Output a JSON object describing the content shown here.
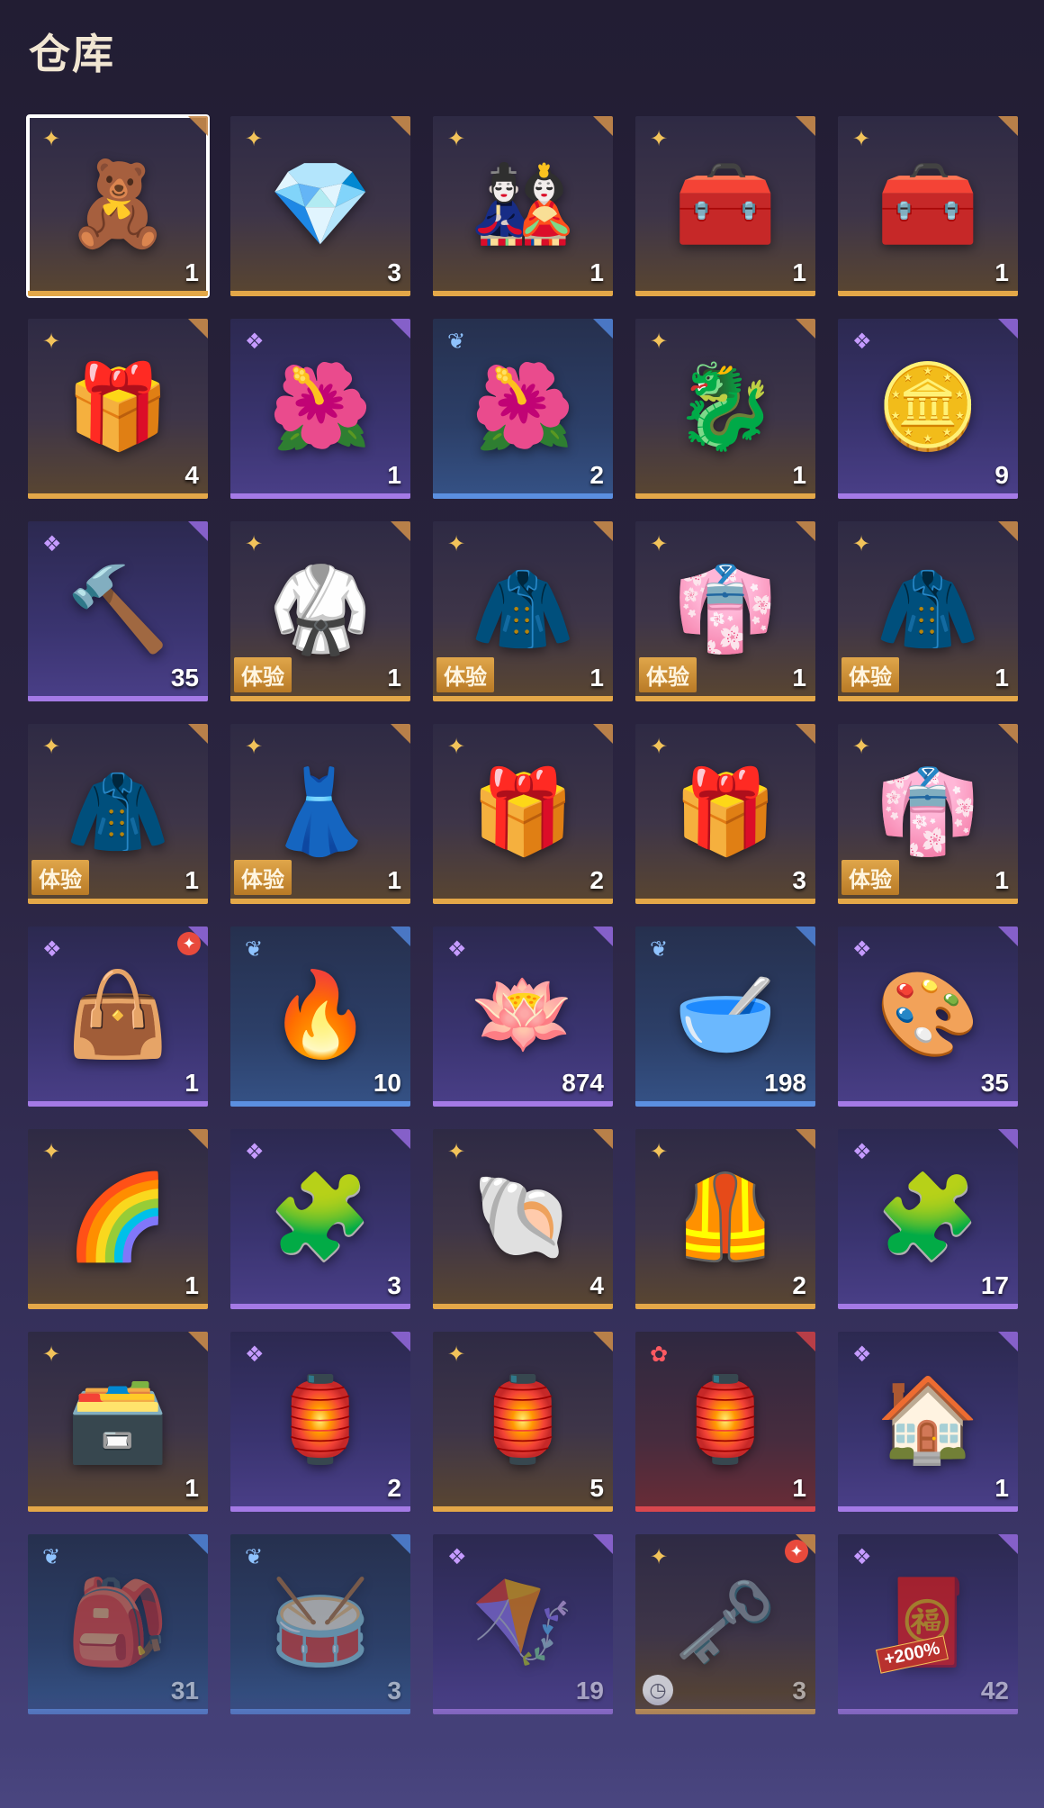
{
  "header": {
    "title": "仓库"
  },
  "trial_label": "体验",
  "items": [
    {
      "rarity": "gold",
      "art": "🧸",
      "qty": "1",
      "selected": true
    },
    {
      "rarity": "gold",
      "art": "💎",
      "qty": "3"
    },
    {
      "rarity": "gold",
      "art": "🎎",
      "qty": "1"
    },
    {
      "rarity": "gold",
      "art": "🧰",
      "qty": "1"
    },
    {
      "rarity": "gold",
      "art": "🧰",
      "qty": "1"
    },
    {
      "rarity": "gold",
      "art": "🎁",
      "qty": "4"
    },
    {
      "rarity": "purple",
      "art": "🌺",
      "qty": "1"
    },
    {
      "rarity": "blue",
      "art": "🌺",
      "qty": "2"
    },
    {
      "rarity": "gold",
      "art": "🐉",
      "qty": "1"
    },
    {
      "rarity": "purple",
      "art": "🪙",
      "qty": "9"
    },
    {
      "rarity": "purple",
      "art": "🔨",
      "qty": "35"
    },
    {
      "rarity": "gold",
      "art": "🥋",
      "qty": "1",
      "trial": true
    },
    {
      "rarity": "gold",
      "art": "🧥",
      "qty": "1",
      "trial": true
    },
    {
      "rarity": "gold",
      "art": "👘",
      "qty": "1",
      "trial": true
    },
    {
      "rarity": "gold",
      "art": "🧥",
      "qty": "1",
      "trial": true
    },
    {
      "rarity": "gold",
      "art": "🧥",
      "qty": "1",
      "trial": true
    },
    {
      "rarity": "gold",
      "art": "👗",
      "qty": "1",
      "trial": true
    },
    {
      "rarity": "gold",
      "art": "🎁",
      "qty": "2"
    },
    {
      "rarity": "gold",
      "art": "🎁",
      "qty": "3"
    },
    {
      "rarity": "gold",
      "art": "👘",
      "qty": "1",
      "trial": true
    },
    {
      "rarity": "purple",
      "art": "👜",
      "qty": "1",
      "badge": true
    },
    {
      "rarity": "blue",
      "art": "🔥",
      "qty": "10"
    },
    {
      "rarity": "purple",
      "art": "🪷",
      "qty": "874"
    },
    {
      "rarity": "blue",
      "art": "🥣",
      "qty": "198"
    },
    {
      "rarity": "purple",
      "art": "🎨",
      "qty": "35"
    },
    {
      "rarity": "gold",
      "art": "🌈",
      "qty": "1"
    },
    {
      "rarity": "purple",
      "art": "🧩",
      "qty": "3"
    },
    {
      "rarity": "gold",
      "art": "🐚",
      "qty": "4"
    },
    {
      "rarity": "gold",
      "art": "🦺",
      "qty": "2"
    },
    {
      "rarity": "purple",
      "art": "🧩",
      "qty": "17"
    },
    {
      "rarity": "gold",
      "art": "🗃️",
      "qty": "1"
    },
    {
      "rarity": "purple",
      "art": "🏮",
      "qty": "2"
    },
    {
      "rarity": "gold",
      "art": "🏮",
      "qty": "5"
    },
    {
      "rarity": "red",
      "art": "🏮",
      "qty": "1"
    },
    {
      "rarity": "purple",
      "art": "🏠",
      "qty": "1"
    },
    {
      "rarity": "blue",
      "art": "🎒",
      "qty": "31",
      "faded": true
    },
    {
      "rarity": "blue",
      "art": "🥁",
      "qty": "3",
      "faded": true
    },
    {
      "rarity": "purple",
      "art": "🪁",
      "qty": "19",
      "faded": true
    },
    {
      "rarity": "gold",
      "art": "🗝️",
      "qty": "3",
      "faded": true,
      "badge": true,
      "clock": true
    },
    {
      "rarity": "purple",
      "art": "🧧",
      "qty": "42",
      "faded": true,
      "overlay": "+200%"
    }
  ],
  "rarity_icons": {
    "gold": "✦",
    "purple": "❖",
    "blue": "❦",
    "red": "✿"
  },
  "colors": {
    "gold": "#e3a748",
    "purple": "#a47ae6",
    "blue": "#5b8fe0",
    "red": "#d9474e"
  }
}
